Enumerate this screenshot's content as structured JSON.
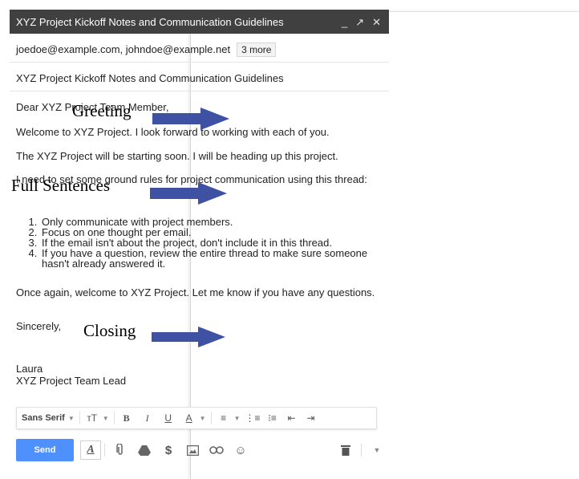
{
  "compose": {
    "title": "XYZ Project Kickoff Notes and Communication Guidelines",
    "window_controls": {
      "minimize": "_",
      "expand": "↗",
      "close": "✕"
    },
    "to": "joedoe@example.com, johndoe@example.net",
    "more_chip": "3 more",
    "subject": "XYZ Project Kickoff Notes and Communication Guidelines"
  },
  "body": {
    "greeting": "Dear XYZ Project Team Member,",
    "welcome": "Welcome to XYZ Project. I look forward to working with each of you.",
    "starting": "The XYZ Project will be starting soon. I will be heading up this project.",
    "ground_rules": "I need to set some ground rules for project communication using this thread:",
    "rules": [
      "Only communicate with project members.",
      "Focus on one thought per email.",
      "If the email isn't about the project, don't include it in this thread.",
      "If you have a question, review the entire thread to make sure someone hasn't already answered it."
    ],
    "again": "Once again, welcome to XYZ Project. Let me know if you have any questions.",
    "sincerely": "Sincerely,",
    "signature_name": "Laura",
    "signature_role": "XYZ Project Team Lead"
  },
  "format_toolbar": {
    "font": "Sans Serif",
    "size_icon": "ᴛT",
    "bold": "B",
    "italic": "I",
    "underline": "U",
    "text_color": "A"
  },
  "action_bar": {
    "send": "Send"
  },
  "annotations": {
    "greeting": "Greeting",
    "full_sentences": "Full Sentences",
    "closing": "Closing"
  },
  "colors": {
    "arrow": "#3f51a3",
    "send": "#4d90fe",
    "titlebar": "#404040"
  }
}
